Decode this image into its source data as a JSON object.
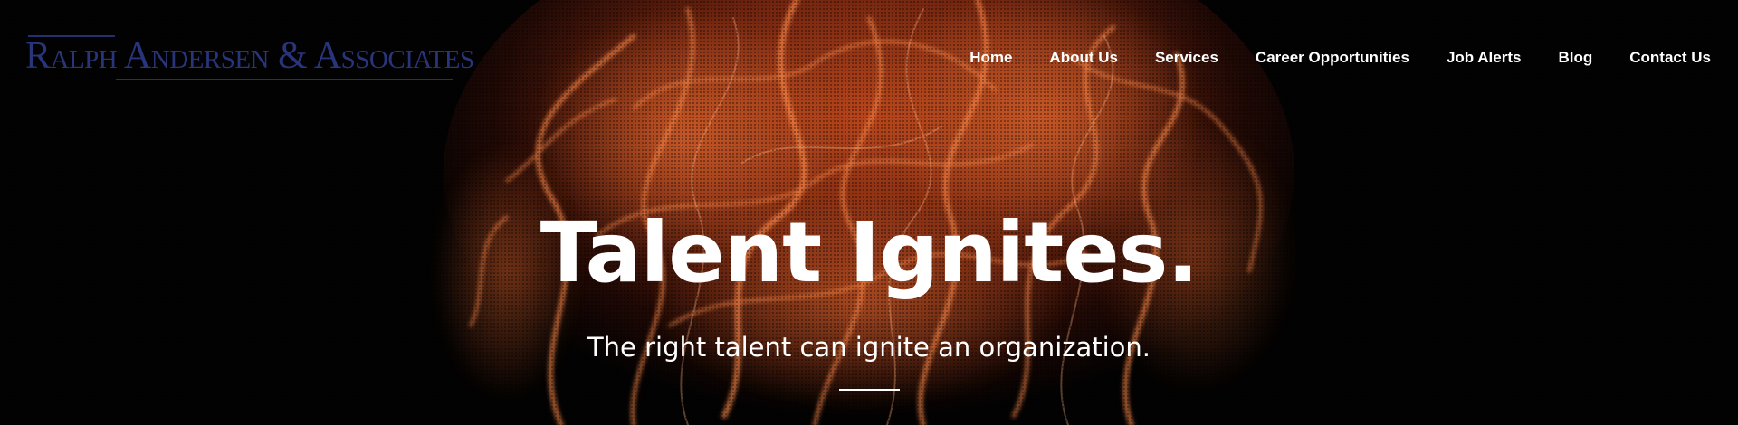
{
  "brand": {
    "logo_text": "Ralph Andersen & Associates",
    "color": "#28357a"
  },
  "nav": {
    "items": [
      {
        "label": "Home"
      },
      {
        "label": "About Us"
      },
      {
        "label": "Services"
      },
      {
        "label": "Career Opportunities"
      },
      {
        "label": "Job Alerts"
      },
      {
        "label": "Blog"
      },
      {
        "label": "Contact Us"
      }
    ]
  },
  "hero": {
    "headline": "Talent Ignites.",
    "subheadline": "The right talent can ignite an organization.",
    "background": "flame-smoke-image",
    "accent_colors": [
      "#000000",
      "#c8501e",
      "#ff7a3a"
    ]
  }
}
